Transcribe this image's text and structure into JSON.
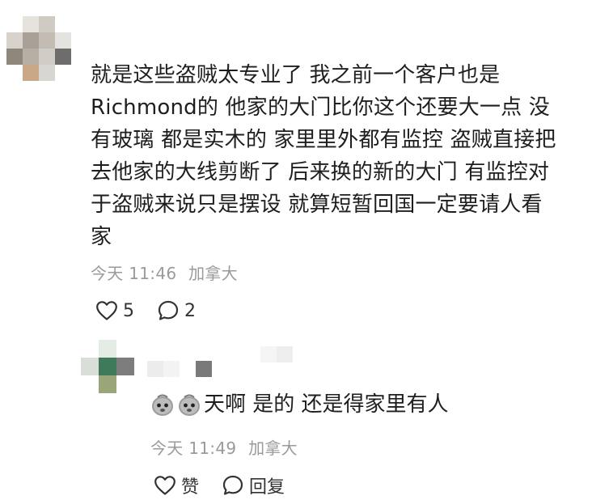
{
  "comment": {
    "text": "就是这些盗贼太专业了 我之前一个客户也是\nRichmond的 他家的大门比你这个还要大一点 没\n有玻璃 都是实木的 家里里外都有监控 盗贼直接把\n去他家的大线剪断了 后来换的新的大门 有监控对\n于盗贼来说只是摆设 就算短暂回国一定要请人看\n家",
    "time": "今天 11:46",
    "location": "加拿大",
    "like_count": "5",
    "reply_count": "2"
  },
  "reply": {
    "emoji_name": "sad-face-emoji",
    "text": "天啊 是的 还是得家里有人",
    "time": "今天 11:49",
    "location": "加拿大",
    "like_label": "赞",
    "reply_label": "回复"
  },
  "colors": {
    "text": "#1e1e1e",
    "meta": "#9a9a9a",
    "icon": "#333333"
  }
}
